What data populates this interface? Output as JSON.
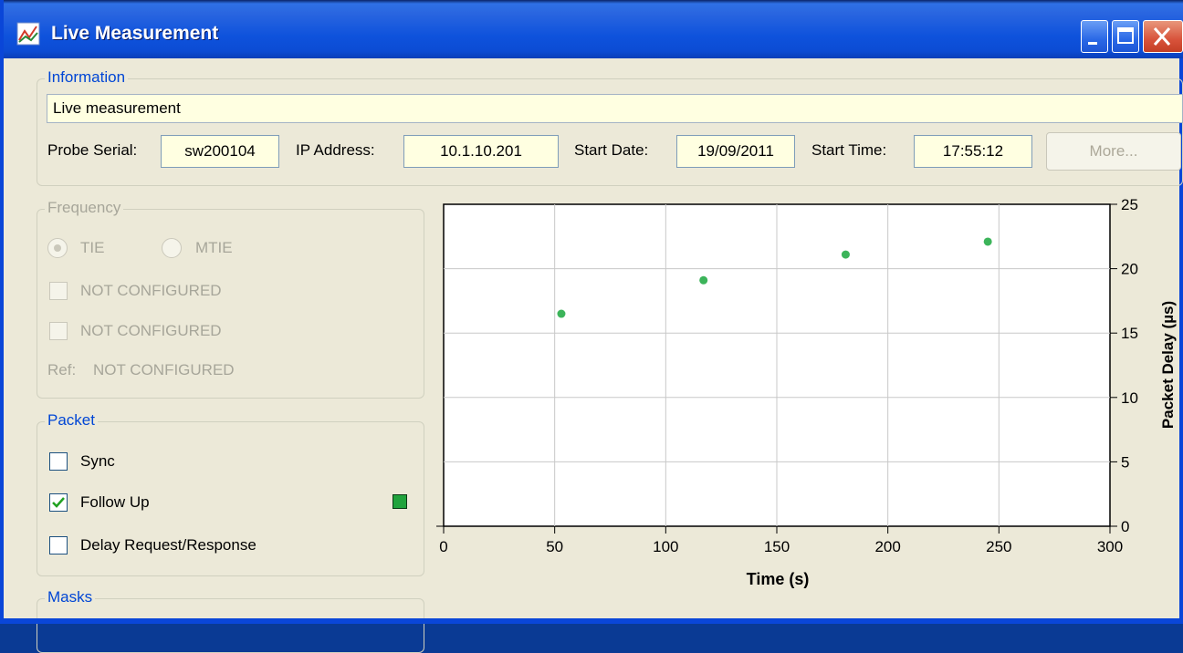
{
  "window": {
    "title": "Live Measurement",
    "icon": "chart-window-icon",
    "buttons": [
      "minimize",
      "maximize",
      "close"
    ]
  },
  "information": {
    "legend": "Information",
    "description": "Live measurement",
    "probe_serial_label": "Probe Serial:",
    "probe_serial": "sw200104",
    "ip_label": "IP Address:",
    "ip": "10.1.10.201",
    "start_date_label": "Start Date:",
    "start_date": "19/09/2011",
    "start_time_label": "Start Time:",
    "start_time": "17:55:12",
    "more_button": "More..."
  },
  "frequency": {
    "legend": "Frequency",
    "radio_tie": "TIE",
    "radio_mtie": "MTIE",
    "selected": "TIE",
    "option1": "NOT CONFIGURED",
    "option2": "NOT CONFIGURED",
    "ref_label": "Ref:",
    "ref_value": "NOT CONFIGURED"
  },
  "packet": {
    "legend": "Packet",
    "items": [
      {
        "label": "Sync",
        "checked": false
      },
      {
        "label": "Follow Up",
        "checked": true
      },
      {
        "label": "Delay Request/Response",
        "checked": false
      }
    ],
    "status_color": "#21a33d"
  },
  "masks": {
    "legend": "Masks"
  },
  "chart_data": {
    "type": "scatter",
    "xlabel": "Time (s)",
    "ylabel": "Packet Delay (µs)",
    "xlim": [
      0,
      300
    ],
    "ylim": [
      0,
      25
    ],
    "x_ticks": [
      "0",
      "50",
      "100",
      "150",
      "200",
      "250",
      "300"
    ],
    "y_ticks": [
      "0",
      "5",
      "10",
      "15",
      "20",
      "25"
    ],
    "grid": true,
    "y_axis_side": "right",
    "marker_color": "#3cb45a",
    "points": [
      {
        "x": 53,
        "y": 16.5
      },
      {
        "x": 117,
        "y": 19.1
      },
      {
        "x": 181,
        "y": 21.1
      },
      {
        "x": 245,
        "y": 22.1
      }
    ]
  }
}
